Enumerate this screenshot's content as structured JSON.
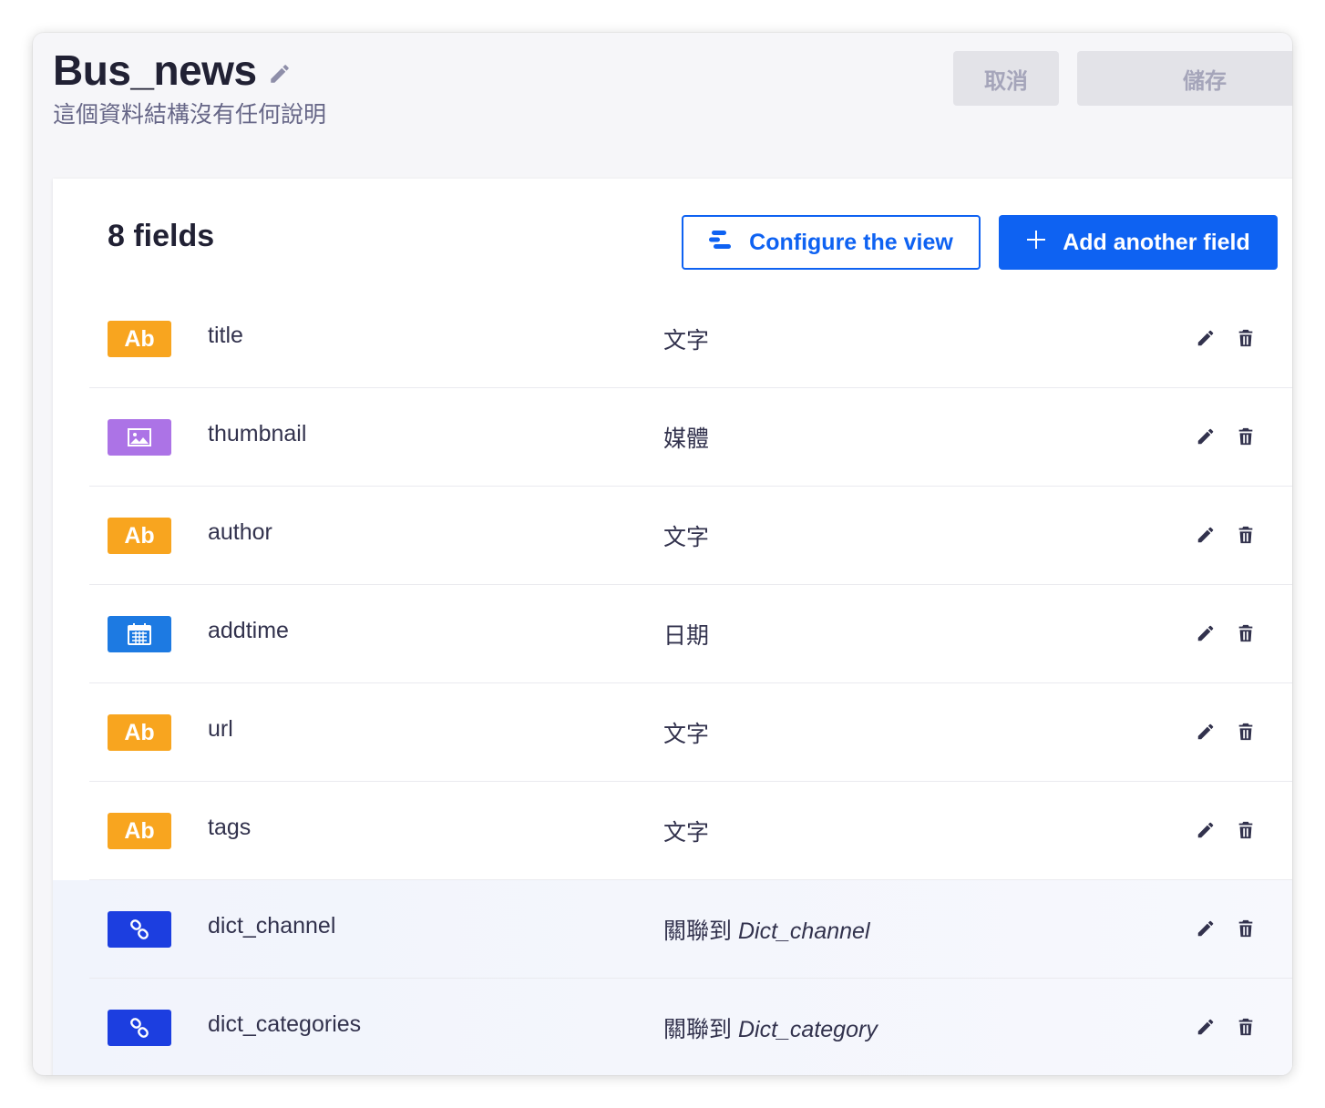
{
  "header": {
    "title": "Bus_news",
    "subtitle": "這個資料結構沒有任何說明",
    "cancel_label": "取消",
    "save_label": "儲存"
  },
  "toolbar": {
    "fields_count": "8 fields",
    "configure_label": "Configure the view",
    "add_field_label": "Add another field"
  },
  "fields": [
    {
      "name": "title",
      "type": "文字",
      "icon": "text-icon",
      "badge_text": "Ab",
      "badge_color": "#f8a51f"
    },
    {
      "name": "thumbnail",
      "type": "媒體",
      "icon": "image-icon",
      "badge_text": "",
      "badge_color": "#ac73e6"
    },
    {
      "name": "author",
      "type": "文字",
      "icon": "text-icon",
      "badge_text": "Ab",
      "badge_color": "#f8a51f"
    },
    {
      "name": "addtime",
      "type": "日期",
      "icon": "calendar-icon",
      "badge_text": "",
      "badge_color": "#1d7ae2"
    },
    {
      "name": "url",
      "type": "文字",
      "icon": "text-icon",
      "badge_text": "Ab",
      "badge_color": "#f8a51f"
    },
    {
      "name": "tags",
      "type": "文字",
      "icon": "text-icon",
      "badge_text": "Ab",
      "badge_color": "#f8a51f"
    },
    {
      "name": "dict_channel",
      "type": "關聯到",
      "relation_target": "Dict_channel",
      "icon": "link-icon",
      "badge_text": "",
      "badge_color": "#1c3ee0"
    },
    {
      "name": "dict_categories",
      "type": "關聯到",
      "relation_target": "Dict_category",
      "icon": "link-icon",
      "badge_text": "",
      "badge_color": "#1c3ee0"
    }
  ],
  "colors": {
    "primary": "#0e62f2",
    "text": "#212134",
    "muted": "#666687",
    "disabled_bg": "#e3e3e8",
    "disabled_text": "#a5a5ba"
  }
}
